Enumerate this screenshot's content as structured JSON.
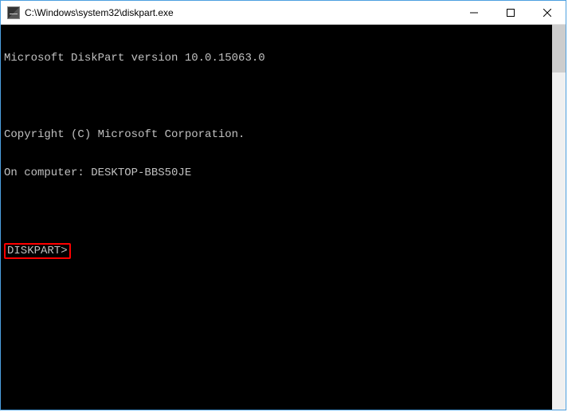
{
  "window": {
    "title": "C:\\Windows\\system32\\diskpart.exe"
  },
  "terminal": {
    "line1": "Microsoft DiskPart version 10.0.15063.0",
    "line2": "",
    "line3": "Copyright (C) Microsoft Corporation.",
    "line4": "On computer: DESKTOP-BBS50JE",
    "line5": "",
    "prompt": "DISKPART>"
  }
}
